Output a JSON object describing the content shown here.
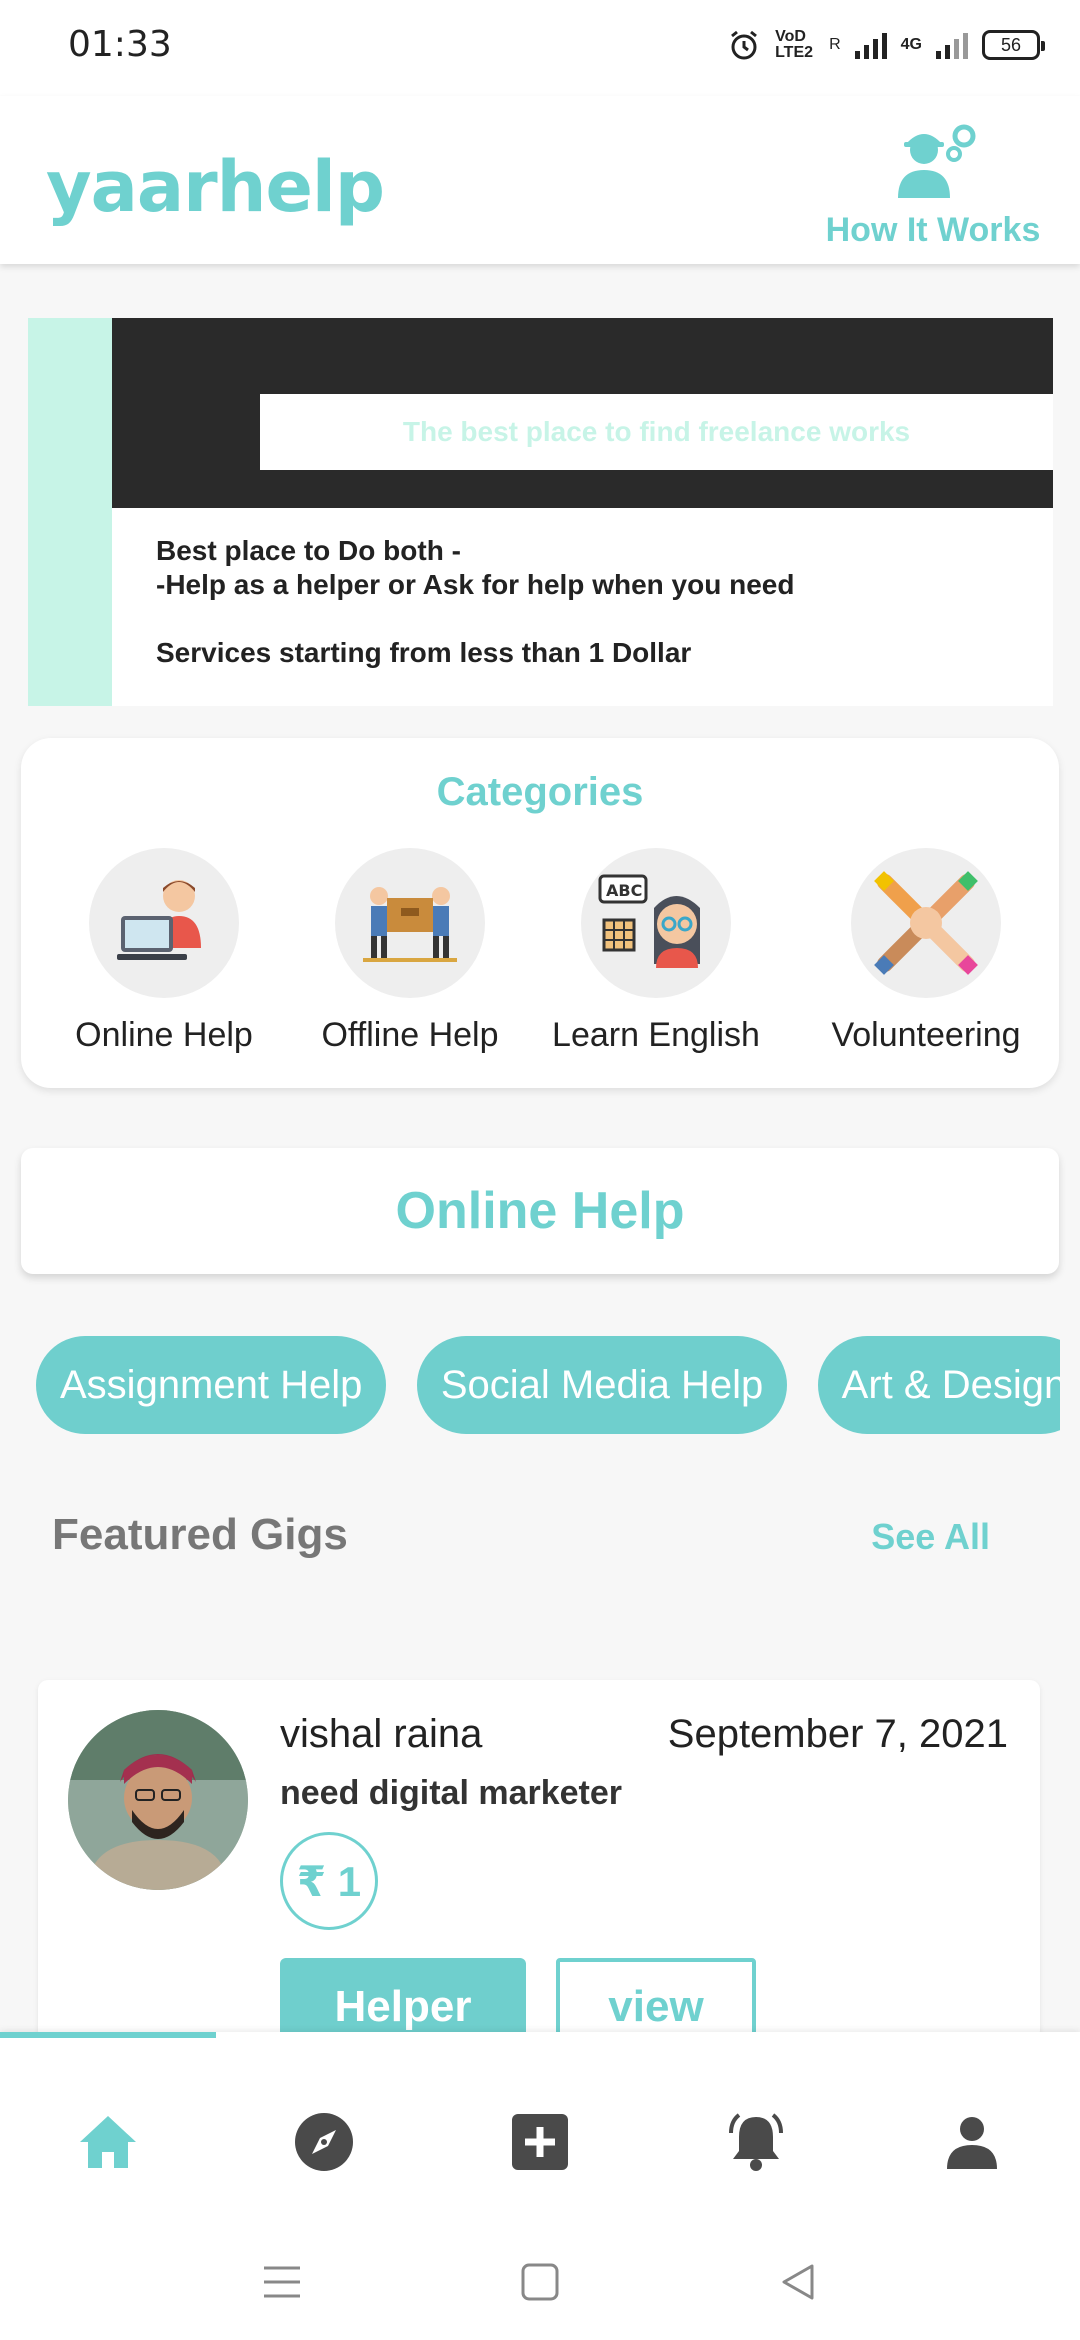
{
  "status_bar": {
    "time": "01:33",
    "network_volte": "VoD LTE2",
    "network_gen": "4G",
    "sim_label": "R",
    "battery": "56"
  },
  "header": {
    "logo": "yaarhelp",
    "how_it_works": "How It Works",
    "how_it_works_icon": "worker-gear-icon"
  },
  "banner": {
    "tagline": "The best place to find freelance works",
    "line1": "Best place to Do both -",
    "line2": "-Help as a helper or Ask for help when you need",
    "line3": "Services starting from less than 1 Dollar"
  },
  "categories": {
    "title": "Categories",
    "items": [
      {
        "label": "Online Help",
        "icon": "person-at-computer-icon"
      },
      {
        "label": "Offline Help",
        "icon": "people-carrying-box-icon"
      },
      {
        "label": "Learn English",
        "icon": "woman-learning-abc-icon"
      },
      {
        "label": "Volunteering",
        "icon": "joined-hands-icon"
      }
    ]
  },
  "section": {
    "title": "Online Help"
  },
  "chips": [
    "Assignment Help",
    "Social Media Help",
    "Art & Design"
  ],
  "featured": {
    "title": "Featured Gigs",
    "see_all": "See All"
  },
  "gig": {
    "name": "vishal raina",
    "date": "September 7, 2021",
    "title": "need digital marketer",
    "price": "₹ 1",
    "helper_label": "Helper",
    "view_label": "view"
  },
  "bottom_nav": {
    "active": "home",
    "items": [
      "home",
      "explore",
      "add",
      "notifications",
      "profile"
    ]
  },
  "colors": {
    "accent": "#6fd1cf",
    "banner_mint": "#c7f4e7",
    "banner_dark": "#2a2a2a"
  }
}
